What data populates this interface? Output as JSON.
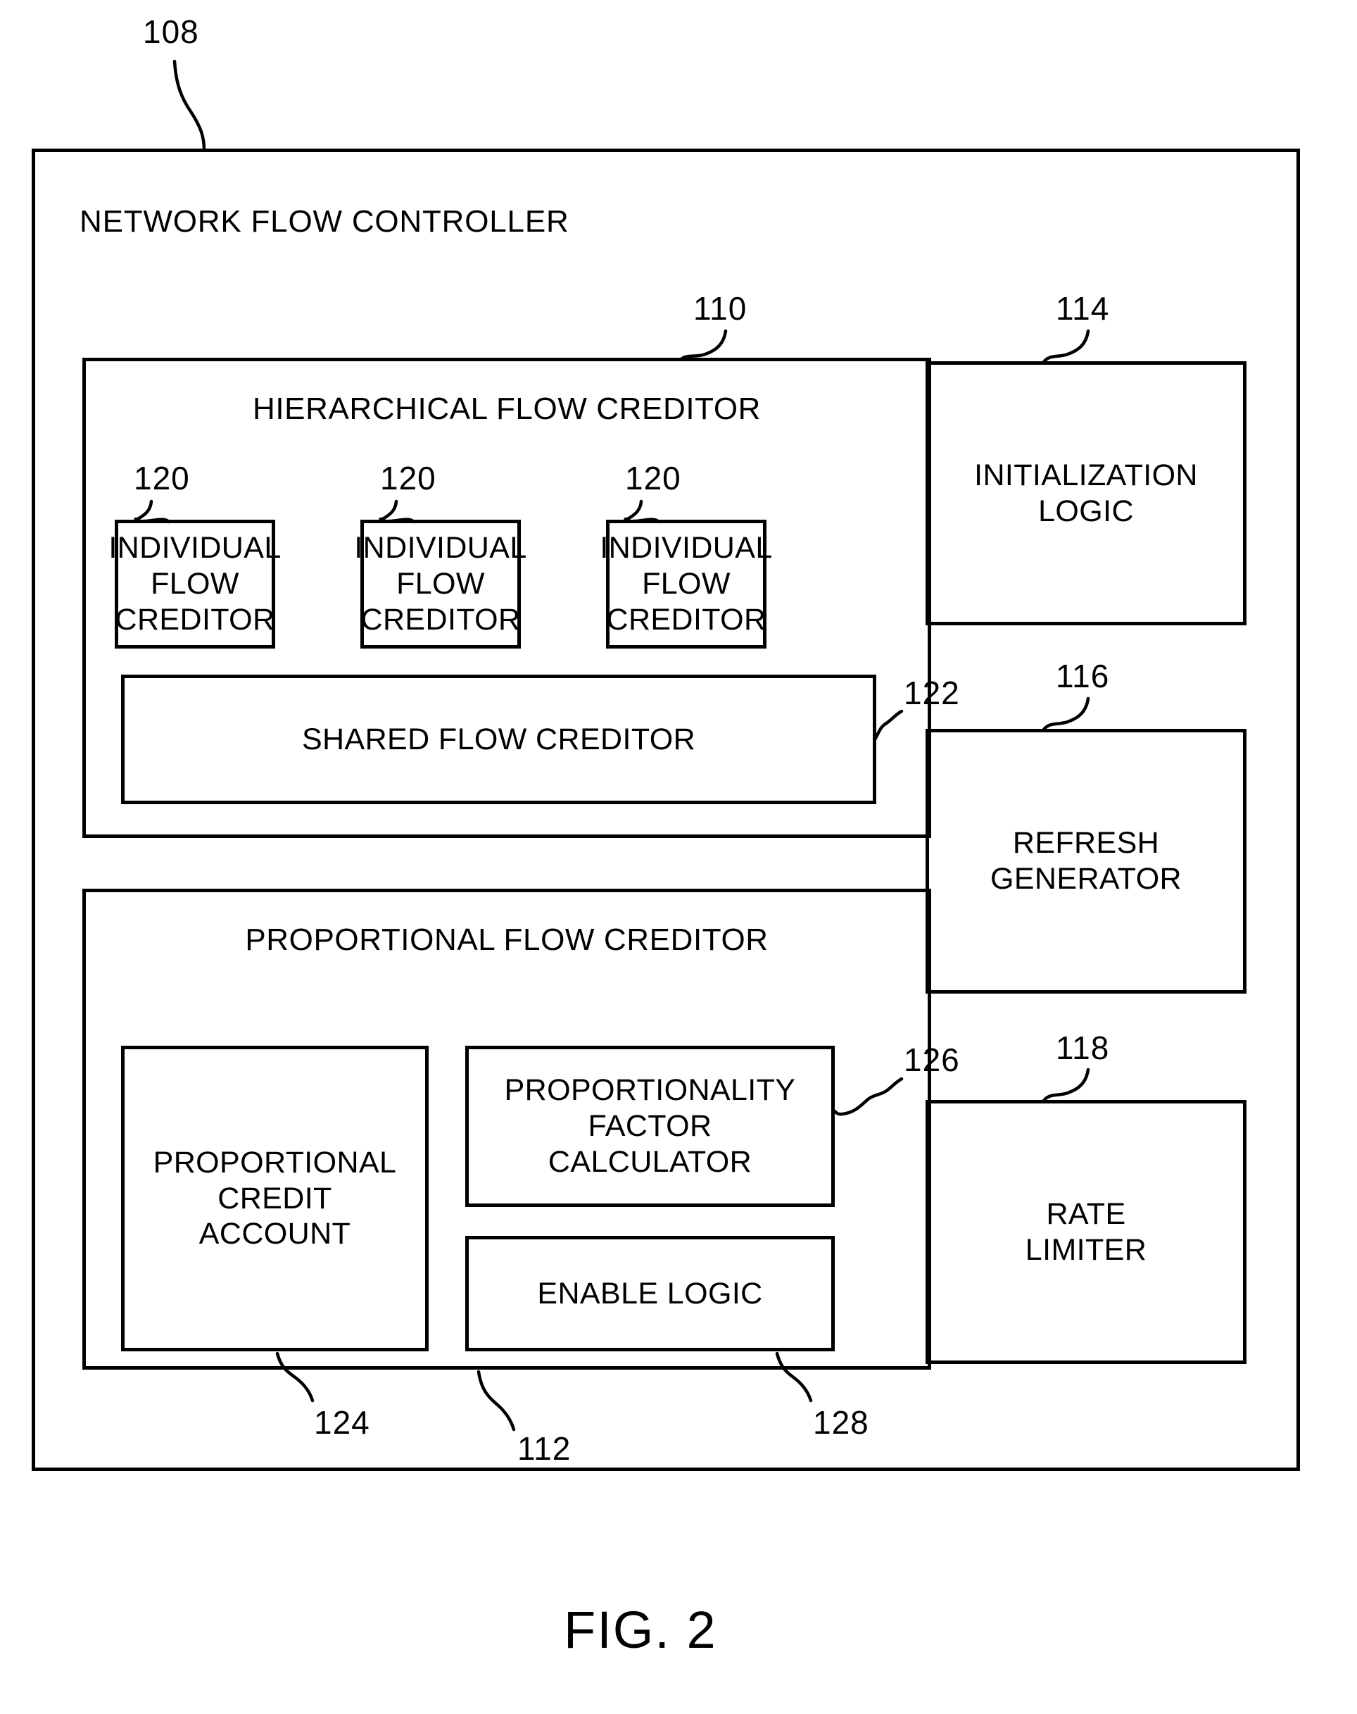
{
  "figure": {
    "caption": "FIG. 2",
    "outer": {
      "title": "NETWORK FLOW CONTROLLER",
      "ref": "108"
    },
    "hierarchical": {
      "title": "HIERARCHICAL FLOW CREDITOR",
      "ref": "110",
      "individual_creditors": [
        {
          "label": "INDIVIDUAL\nFLOW\nCREDITOR",
          "ref": "120"
        },
        {
          "label": "INDIVIDUAL\nFLOW\nCREDITOR",
          "ref": "120"
        },
        {
          "label": "INDIVIDUAL\nFLOW\nCREDITOR",
          "ref": "120"
        }
      ],
      "shared": {
        "label": "SHARED FLOW CREDITOR",
        "ref": "122"
      }
    },
    "proportional": {
      "title": "PROPORTIONAL FLOW CREDITOR",
      "ref": "112",
      "credit_account": {
        "label": "PROPORTIONAL\nCREDIT\nACCOUNT",
        "ref": "124"
      },
      "factor_calculator": {
        "label": "PROPORTIONALITY\nFACTOR\nCALCULATOR",
        "ref": "126"
      },
      "enable_logic": {
        "label": "ENABLE LOGIC",
        "ref": "128"
      }
    },
    "right_column": [
      {
        "label": "INITIALIZATION\nLOGIC",
        "ref": "114"
      },
      {
        "label": "REFRESH\nGENERATOR",
        "ref": "116"
      },
      {
        "label": "RATE\nLIMITER",
        "ref": "118"
      }
    ],
    "colors": {
      "stroke": "#000000",
      "background": "#ffffff"
    }
  }
}
